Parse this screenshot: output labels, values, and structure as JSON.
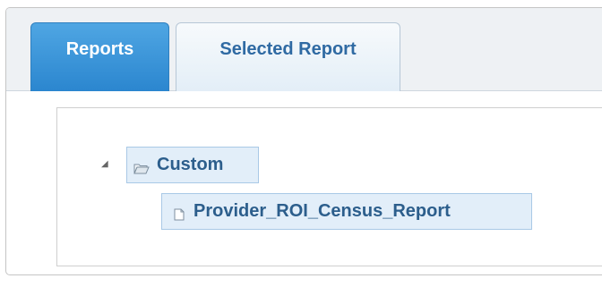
{
  "tabs": [
    {
      "label": "Reports",
      "active": true
    },
    {
      "label": "Selected Report",
      "active": false
    }
  ],
  "tree": {
    "expand_toggle_icon": "triangle-expanded-icon",
    "folder": {
      "label": "Custom",
      "icon": "folder-open-icon",
      "expanded": true,
      "children": [
        {
          "label": "Provider_ROI_Census_Report",
          "icon": "document-icon"
        }
      ]
    }
  },
  "colors": {
    "active_tab": "#2b86cf",
    "inactive_tab_text": "#2f6aa3",
    "node_background": "#e2eef9",
    "node_border": "#a9c9e6",
    "node_text": "#2c5e8c"
  }
}
